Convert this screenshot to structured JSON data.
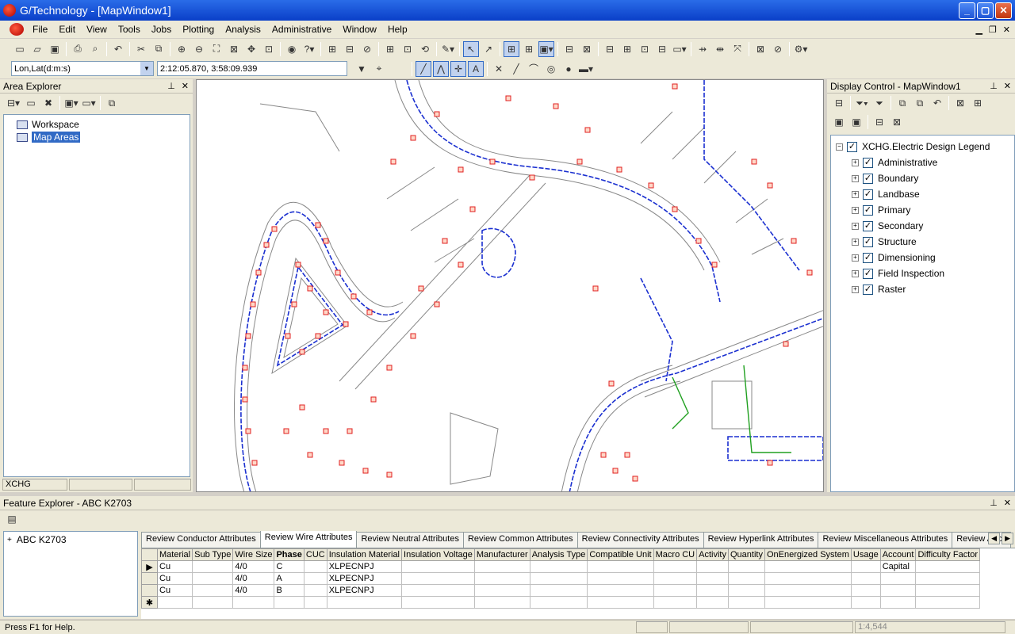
{
  "window": {
    "title": "G/Technology - [MapWindow1]"
  },
  "menu": [
    "File",
    "Edit",
    "View",
    "Tools",
    "Jobs",
    "Plotting",
    "Analysis",
    "Administrative",
    "Window",
    "Help"
  ],
  "coord": {
    "system": "Lon,Lat(d:m:s)",
    "value": "2:12:05.870, 3:58:09.939"
  },
  "area_explorer": {
    "title": "Area Explorer",
    "items": [
      "Workspace",
      "Map Areas"
    ],
    "status": "XCHG"
  },
  "display_control": {
    "title": "Display Control - MapWindow1",
    "root": "XCHG.Electric Design Legend",
    "layers": [
      "Administrative",
      "Boundary",
      "Landbase",
      "Primary",
      "Secondary",
      "Structure",
      "Dimensioning",
      "Field Inspection",
      "Raster"
    ]
  },
  "feature_explorer": {
    "title": "Feature Explorer - ABC  K2703",
    "tree_item": "ABC  K2703",
    "tabs": [
      "Review Conductor Attributes",
      "Review Wire Attributes",
      "Review Neutral Attributes",
      "Review Common Attributes",
      "Review Connectivity Attributes",
      "Review Hyperlink Attributes",
      "Review Miscellaneous Attributes",
      "Review Ancil"
    ],
    "active_tab": 1,
    "columns": [
      "Material",
      "Sub Type",
      "Wire Size",
      "Phase",
      "CUC",
      "Insulation Material",
      "Insulation Voltage",
      "Manufacturer",
      "Analysis Type",
      "Compatible Unit",
      "Macro CU",
      "Activity",
      "Quantity",
      "OnEnergized System",
      "Usage",
      "Account",
      "Difficulty Factor"
    ],
    "rows": [
      [
        "Cu",
        "",
        "4/0",
        "C",
        "",
        "XLPECNPJ",
        "",
        "",
        "",
        "",
        "",
        "",
        "",
        "",
        "",
        "Capital",
        ""
      ],
      [
        "Cu",
        "",
        "4/0",
        "A",
        "",
        "XLPECNPJ",
        "",
        "",
        "",
        "",
        "",
        "",
        "",
        "",
        "",
        "",
        ""
      ],
      [
        "Cu",
        "",
        "4/0",
        "B",
        "",
        "XLPECNPJ",
        "",
        "",
        "",
        "",
        "",
        "",
        "",
        "",
        "",
        "",
        ""
      ]
    ]
  },
  "status": {
    "help": "Press F1 for Help.",
    "scale": "1:4,544"
  },
  "colors": {
    "titlebar": "#0a3fc8",
    "primary_line": "#1a2fd0",
    "feature": "#e02020",
    "secondary_line": "#20a020"
  }
}
